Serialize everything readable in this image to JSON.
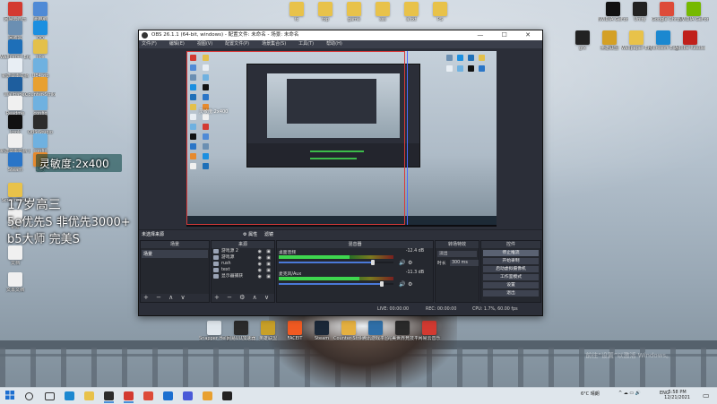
{
  "desktop": {
    "left_icons": [
      {
        "label": "网易云音乐",
        "color": "#d33a31"
      },
      {
        "label": "此电脑",
        "color": "#4f8ad6"
      },
      {
        "label": "回收站",
        "color": "#6b8fb2"
      },
      {
        "label": "QQ",
        "color": "#1b8fe0"
      },
      {
        "label": "Wallpaper Engine",
        "color": "#1e6fb8"
      },
      {
        "label": "obs",
        "color": "#e3c04a"
      },
      {
        "label": "新建文本文档",
        "color": "#e8eef4"
      },
      {
        "label": "UE4.zip",
        "color": "#6fb1e0"
      },
      {
        "label": "Wallpaper",
        "color": "#1e5e9e"
      },
      {
        "label": "Counter-Strike",
        "color": "#e8a030"
      },
      {
        "label": "Readme",
        "color": "#f0f0f0"
      },
      {
        "label": "config",
        "color": "#6fb1e0"
      },
      {
        "label": "kook",
        "color": "#111111"
      },
      {
        "label": "OBS Studio",
        "color": "#2c2c2c"
      },
      {
        "label": "新建文本文档 (2)",
        "color": "#f0f0f0"
      },
      {
        "label": "config",
        "color": "#6fb1e0"
      },
      {
        "label": "Steam",
        "color": "#2a75c7"
      },
      {
        "label": "我的",
        "color": "#e68a2e"
      }
    ],
    "left_lower_icons": [
      {
        "label": "Screenshots",
        "color": "#e8c24a"
      },
      {
        "label": "新建",
        "color": "#f0f0f0"
      },
      {
        "label": "文档",
        "color": "#f0f0f0"
      },
      {
        "label": "文本文档",
        "color": "#f0f0f0"
      }
    ],
    "top_folders": [
      "fc",
      "fop",
      "game",
      "sss",
      "a.txt",
      "PS"
    ],
    "right_icons": [
      {
        "label": "NVIDIA GeForce",
        "color": "#111111"
      },
      {
        "label": "Unity",
        "color": "#222222"
      },
      {
        "label": "Google Chrome",
        "color": "#dd4b39"
      },
      {
        "label": "NVIDIA GeForce Experience",
        "color": "#76b900"
      },
      {
        "label": "gfx",
        "color": "#222222"
      },
      {
        "label": "英雄联盟",
        "color": "#d4a025"
      },
      {
        "label": "Wallpaper Engine",
        "color": "#e8c24a"
      },
      {
        "label": "Microsoft Edge",
        "color": "#1b88d0"
      },
      {
        "label": "Adobe Reader",
        "color": "#c0201a"
      }
    ],
    "bottom_icons": [
      {
        "label": "Snapper Helper",
        "color": "#dfe6ec"
      },
      {
        "label": "网易UU加速器",
        "color": "#2b2b2b"
      },
      {
        "label": "英雄联盟",
        "color": "#c8a028"
      },
      {
        "label": "FACEIT",
        "color": "#f05a22"
      },
      {
        "label": "Steam",
        "color": "#1b2838"
      },
      {
        "label": "Counter-Strike Global Offe...",
        "color": "#e5b040"
      },
      {
        "label": "腾讯游戏平台",
        "color": "#2f6fa8"
      },
      {
        "label": "完美世界竞技平台",
        "color": "#2a2a2a"
      },
      {
        "label": "网易云音乐",
        "color": "#d33a31"
      }
    ]
  },
  "overlay": {
    "sensitivity": "灵敏度:2x400",
    "line1": "17岁高三",
    "line2": "5e优先S 非优先3000+",
    "line3": "b5大师 完美S",
    "watermark": "前往“设置”以激活 Windows。"
  },
  "obs": {
    "title": "OBS 26.1.1 (64-bit, windows) - 配置文件: 未命名 - 场景: 未命名",
    "window_buttons": "— ☐ ✕",
    "menu": [
      "文件(F)",
      "编辑(E)",
      "视图(V)",
      "配置文件(P)",
      "场景集合(S)",
      "工具(T)",
      "帮助(H)"
    ],
    "ctrlbar": {
      "no_source": "未选择来源",
      "props": "⚙ 属性",
      "filters": "滤镜"
    },
    "docks": {
      "scenes": "场景",
      "sources": "来源",
      "mixer": "混音器",
      "transitions": "转场特效",
      "controls": "控件"
    },
    "scenes": [
      "场景"
    ],
    "sources": [
      {
        "name": "游戏源 2"
      },
      {
        "name": "游戏源"
      },
      {
        "name": "rush"
      },
      {
        "name": "text"
      },
      {
        "name": "显示器捕获"
      }
    ],
    "mixer": [
      {
        "name": "桌面音频",
        "db": "-12.4 dB",
        "level_fraction": 0.62,
        "volume_fraction": 0.82
      },
      {
        "name": "麦克风/Aux",
        "db": "-11.3 dB",
        "level_fraction": 0.7,
        "volume_fraction": 0.9
      }
    ],
    "transitions": {
      "type": "淡出",
      "duration_label": "时长",
      "duration": "300 ms"
    },
    "controls": [
      "停止推流",
      "开始录制",
      "启动虚拟摄像机",
      "工作室模式",
      "设置",
      "退出"
    ],
    "status": {
      "live": "LIVE: 00:00:00",
      "rec": "REC: 00:00:00",
      "cpu": "CPU: 1.7%, 60.00 fps"
    },
    "preview_overlay": "灵敏度:2x400"
  },
  "taskbar": {
    "icons": [
      {
        "name": "search",
        "color": "#333333"
      },
      {
        "name": "task-view",
        "color": "#333333"
      },
      {
        "name": "edge",
        "color": "#1b88d0"
      },
      {
        "name": "explorer",
        "color": "#e8c24a"
      },
      {
        "name": "obs",
        "color": "#2c2c2c"
      },
      {
        "name": "netease-music",
        "color": "#d33a31"
      },
      {
        "name": "chrome",
        "color": "#dd4b39"
      },
      {
        "name": "app-blue",
        "color": "#1b6fd0"
      },
      {
        "name": "app-store",
        "color": "#4a5ad8"
      },
      {
        "name": "folder",
        "color": "#e8a030"
      },
      {
        "name": "obs-2",
        "color": "#222222"
      }
    ],
    "weather": "6°C 晴朗",
    "lang": "ENG",
    "time": "5:58 PM",
    "date": "12/21/2021"
  },
  "colors": {
    "obs_bg": "#2b2e38",
    "accent": "#4a79d8",
    "meter_green": "#3ed64e"
  }
}
